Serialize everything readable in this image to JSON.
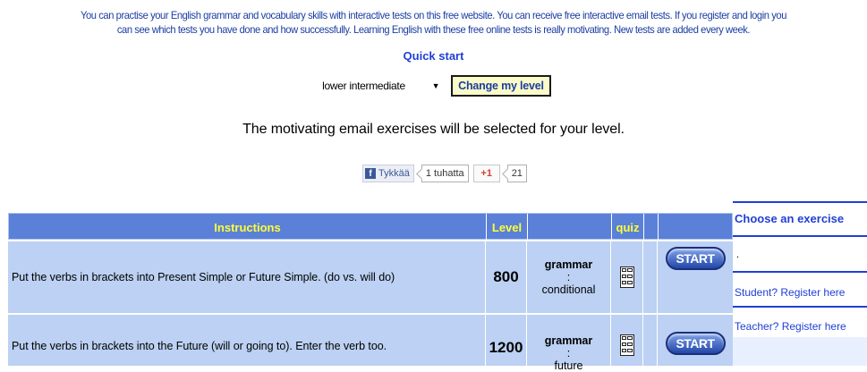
{
  "intro": {
    "line1": "You can practise your English grammar and vocabulary skills with interactive tests on this free website. You can receive free interactive email tests. If you register and login you",
    "line2": "can see which tests you have done and how successfully. Learning English with these free online tests is really motivating. New tests are added every week."
  },
  "quick_start": "Quick start",
  "level_select": {
    "value": "lower intermediate"
  },
  "change_level_label": "Change my level",
  "motivating_text": "The motivating email exercises will be selected for your level.",
  "social": {
    "fb_label": "Tykkää",
    "fb_count": "1 tuhatta",
    "gplus_label": "+1",
    "gplus_count": "21"
  },
  "table": {
    "headers": {
      "instructions": "Instructions",
      "level": "Level",
      "quiz": "quiz"
    },
    "rows": [
      {
        "instruction": "Put the verbs in brackets into Present Simple or Future Simple. (do vs. will do)",
        "level": "800",
        "category": "grammar",
        "topic": "conditional",
        "start_label": "START"
      },
      {
        "instruction": "Put the verbs in brackets into the Future (will or going to). Enter the verb too.",
        "level": "1200",
        "category": "grammar",
        "topic": "future",
        "start_label": "START"
      }
    ]
  },
  "sidebar": {
    "title": "Choose an exercise",
    "dot": ".",
    "student_link": "Student? Register here",
    "teacher_link": "Teacher? Register here"
  },
  "colors": {
    "header_bg": "#5b80d8",
    "header_text": "#ffff33",
    "row_bg": "#bcd1f3",
    "link_blue": "#1f3fd6"
  }
}
